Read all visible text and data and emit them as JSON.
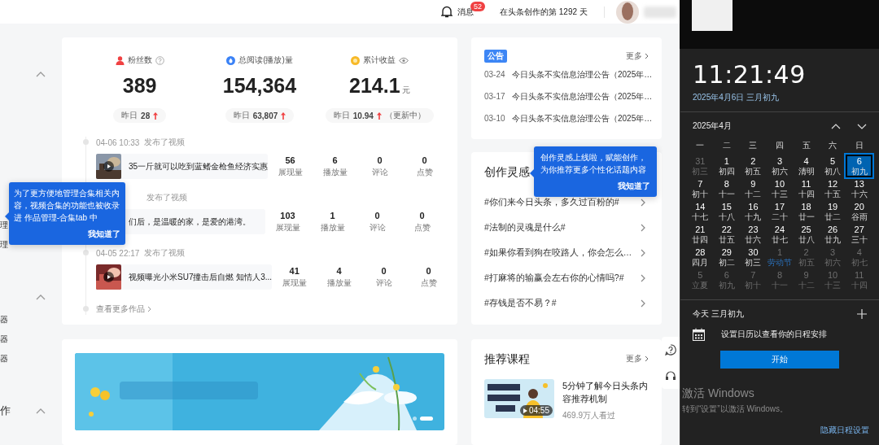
{
  "header": {
    "messages_label": "消息",
    "messages_badge": "52",
    "days_text": "在头条创作的第 1292 天"
  },
  "sidebar": {
    "items": [
      {
        "kind": "group",
        "expanded": true
      },
      {
        "kind": "item",
        "label": "理"
      },
      {
        "kind": "item",
        "label": "理"
      },
      {
        "kind": "group",
        "expanded": true
      },
      {
        "kind": "item",
        "label": "器"
      },
      {
        "kind": "item",
        "label": "器"
      },
      {
        "kind": "item",
        "label": "器"
      },
      {
        "kind": "group",
        "label": "作",
        "expanded": true
      }
    ]
  },
  "stats": [
    {
      "label": "粉丝数",
      "value": "389",
      "yesterday_label": "昨日",
      "yesterday": "28"
    },
    {
      "label": "总阅读(播放)量",
      "value": "154,364",
      "yesterday_label": "昨日",
      "yesterday": "63,807"
    },
    {
      "label": "累计收益",
      "value": "214.1",
      "unit": "元",
      "yesterday_label": "昨日",
      "yesterday": "10.94",
      "note": "（更新中）"
    }
  ],
  "works": [
    {
      "date": "04-06 10:33",
      "action": "发布了视频",
      "title": "35一斤就可以吃到蓝鳍金枪鱼经济实惠",
      "metrics": [
        {
          "value": "56",
          "label": "展现量"
        },
        {
          "value": "6",
          "label": "播放量"
        },
        {
          "value": "0",
          "label": "评论"
        },
        {
          "value": "0",
          "label": "点赞"
        }
      ]
    },
    {
      "action": "发布了视频",
      "title": "们后，是温暖的家，是爱的港湾。",
      "metrics": [
        {
          "value": "103",
          "label": "展现量"
        },
        {
          "value": "1",
          "label": "播放量"
        },
        {
          "value": "0",
          "label": "评论"
        },
        {
          "value": "0",
          "label": "点赞"
        }
      ]
    },
    {
      "date": "04-05 22:17",
      "action": "发布了视频",
      "title": "视频曝光小米SU7撞击后自燃 知情人3...",
      "metrics": [
        {
          "value": "41",
          "label": "展现量"
        },
        {
          "value": "4",
          "label": "播放量"
        },
        {
          "value": "0",
          "label": "评论"
        },
        {
          "value": "0",
          "label": "点赞"
        }
      ]
    }
  ],
  "more_works": "查看更多作品",
  "banner": {
    "kind": "picture",
    "slides": [
      {
        "selected": false
      },
      {
        "selected": true
      }
    ]
  },
  "notice": {
    "tag": "公告",
    "more": "更多",
    "items": [
      {
        "date": "03-24",
        "title": "今日头条不实信息治理公告（2025年…"
      },
      {
        "date": "03-17",
        "title": "今日头条不实信息治理公告（2025年…"
      },
      {
        "date": "03-10",
        "title": "今日头条不实信息治理公告（2025年…"
      }
    ]
  },
  "inspiration": {
    "title": "创作灵感",
    "topics": [
      "#你们来今日头条，多久过百粉的#",
      "#法制的灵魂是什么#",
      "#如果你看到狗在咬路人，你会怎么…",
      "#打麻将的输赢会左右你的心情吗?#",
      "#存钱是否不易？#"
    ]
  },
  "course": {
    "title": "推荐课程",
    "more": "更多",
    "items": [
      {
        "duration": "04:55",
        "title": "5分钟了解今日头条内容推荐机制",
        "views": "469.9万人看过"
      }
    ]
  },
  "tooltips": [
    {
      "text": "为了更方便地管理合集相关内容，视频合集的功能也被收录进 作品管理-合集tab 中",
      "button": "我知道了"
    },
    {
      "text": "创作灵感上线啦，赋能创作，为你推荐更多个性化话题内容",
      "button": "我知道了"
    }
  ],
  "calendar": {
    "time": "11:21:49",
    "date": "2025年4月6日 三月初九",
    "month": "2025年4月",
    "weekdays": [
      "一",
      "二",
      "三",
      "四",
      "五",
      "六",
      "日"
    ],
    "days": [
      {
        "day": "31",
        "lunar": "初三",
        "dim": true,
        "selected": false,
        "holiday": false
      },
      {
        "day": "1",
        "lunar": "初四",
        "dim": false,
        "selected": false,
        "holiday": false
      },
      {
        "day": "2",
        "lunar": "初五",
        "dim": false,
        "selected": false,
        "holiday": false
      },
      {
        "day": "3",
        "lunar": "初六",
        "dim": false,
        "selected": false,
        "holiday": false
      },
      {
        "day": "4",
        "lunar": "清明",
        "dim": false,
        "selected": false,
        "holiday": false
      },
      {
        "day": "5",
        "lunar": "初八",
        "dim": false,
        "selected": false,
        "holiday": false
      },
      {
        "day": "6",
        "lunar": "初九",
        "dim": false,
        "selected": true,
        "holiday": false
      },
      {
        "day": "7",
        "lunar": "初十",
        "dim": false,
        "selected": false,
        "holiday": false
      },
      {
        "day": "8",
        "lunar": "十一",
        "dim": false,
        "selected": false,
        "holiday": false
      },
      {
        "day": "9",
        "lunar": "十二",
        "dim": false,
        "selected": false,
        "holiday": false
      },
      {
        "day": "10",
        "lunar": "十三",
        "dim": false,
        "selected": false,
        "holiday": false
      },
      {
        "day": "11",
        "lunar": "十四",
        "dim": false,
        "selected": false,
        "holiday": false
      },
      {
        "day": "12",
        "lunar": "十五",
        "dim": false,
        "selected": false,
        "holiday": false
      },
      {
        "day": "13",
        "lunar": "十六",
        "dim": false,
        "selected": false,
        "holiday": false
      },
      {
        "day": "14",
        "lunar": "十七",
        "dim": false,
        "selected": false,
        "holiday": false
      },
      {
        "day": "15",
        "lunar": "十八",
        "dim": false,
        "selected": false,
        "holiday": false
      },
      {
        "day": "16",
        "lunar": "十九",
        "dim": false,
        "selected": false,
        "holiday": false
      },
      {
        "day": "17",
        "lunar": "二十",
        "dim": false,
        "selected": false,
        "holiday": false
      },
      {
        "day": "18",
        "lunar": "廿一",
        "dim": false,
        "selected": false,
        "holiday": false
      },
      {
        "day": "19",
        "lunar": "廿二",
        "dim": false,
        "selected": false,
        "holiday": false
      },
      {
        "day": "20",
        "lunar": "谷雨",
        "dim": false,
        "selected": false,
        "holiday": false
      },
      {
        "day": "21",
        "lunar": "廿四",
        "dim": false,
        "selected": false,
        "holiday": false
      },
      {
        "day": "22",
        "lunar": "廿五",
        "dim": false,
        "selected": false,
        "holiday": false
      },
      {
        "day": "23",
        "lunar": "廿六",
        "dim": false,
        "selected": false,
        "holiday": false
      },
      {
        "day": "24",
        "lunar": "廿七",
        "dim": false,
        "selected": false,
        "holiday": false
      },
      {
        "day": "25",
        "lunar": "廿八",
        "dim": false,
        "selected": false,
        "holiday": false
      },
      {
        "day": "26",
        "lunar": "廿九",
        "dim": false,
        "selected": false,
        "holiday": false
      },
      {
        "day": "27",
        "lunar": "三十",
        "dim": false,
        "selected": false,
        "holiday": false
      },
      {
        "day": "28",
        "lunar": "四月",
        "dim": false,
        "selected": false,
        "holiday": false
      },
      {
        "day": "29",
        "lunar": "初二",
        "dim": false,
        "selected": false,
        "holiday": false
      },
      {
        "day": "30",
        "lunar": "初三",
        "dim": false,
        "selected": false,
        "holiday": false
      },
      {
        "day": "1",
        "lunar": "劳动节",
        "dim": true,
        "selected": false,
        "holiday": true
      },
      {
        "day": "2",
        "lunar": "初五",
        "dim": true,
        "selected": false,
        "holiday": false
      },
      {
        "day": "3",
        "lunar": "初六",
        "dim": true,
        "selected": false,
        "holiday": false
      },
      {
        "day": "4",
        "lunar": "初七",
        "dim": true,
        "selected": false,
        "holiday": false
      },
      {
        "day": "5",
        "lunar": "立夏",
        "dim": true,
        "selected": false,
        "holiday": false
      },
      {
        "day": "6",
        "lunar": "初九",
        "dim": true,
        "selected": false,
        "holiday": false
      },
      {
        "day": "7",
        "lunar": "初十",
        "dim": true,
        "selected": false,
        "holiday": false
      },
      {
        "day": "8",
        "lunar": "十一",
        "dim": true,
        "selected": false,
        "holiday": false
      },
      {
        "day": "9",
        "lunar": "十二",
        "dim": true,
        "selected": false,
        "holiday": false
      },
      {
        "day": "10",
        "lunar": "十三",
        "dim": true,
        "selected": false,
        "holiday": false
      },
      {
        "day": "11",
        "lunar": "十四",
        "dim": true,
        "selected": false,
        "holiday": false
      }
    ],
    "today": "今天 三月初九",
    "empty_text": "设置日历以查看你的日程安排",
    "button": "开始",
    "footer": "隐藏日程设置"
  },
  "activation": {
    "title": "激活 Windows",
    "text": "转到“设置”以激活 Windows。"
  }
}
